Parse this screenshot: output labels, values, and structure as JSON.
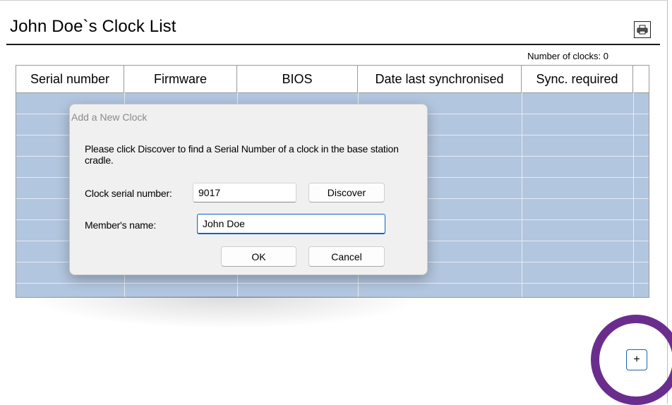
{
  "page": {
    "title": "John Doe`s Clock List",
    "clock_count_label": "Number of clocks: 0",
    "print_icon": "printer-icon"
  },
  "table": {
    "columns": [
      "Serial number",
      "Firmware",
      "BIOS",
      "Date last synchronised",
      "Sync. required"
    ],
    "rows": []
  },
  "dialog": {
    "title": "Add a New Clock",
    "message": "Please click Discover to find a Serial Number of a clock in the base station cradle.",
    "serial_label": "Clock serial number:",
    "serial_value": "9017",
    "discover_label": "Discover",
    "member_label": "Member's name:",
    "member_value": "John Doe",
    "ok_label": "OK",
    "cancel_label": "Cancel"
  },
  "add_button": {
    "label": "+",
    "highlight_color": "#6a2d8e"
  },
  "colors": {
    "grid_background": "#b3c6df",
    "focus_border": "#0b61c9"
  }
}
